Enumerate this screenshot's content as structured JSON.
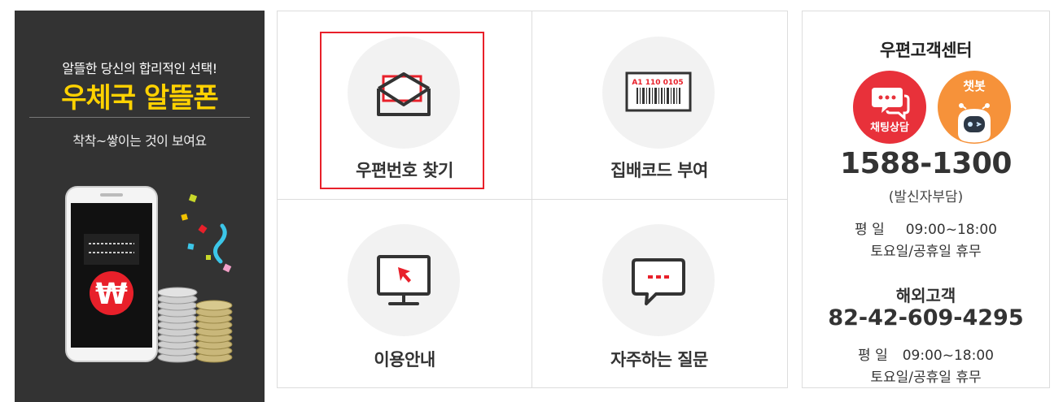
{
  "banner": {
    "tagline": "알뜰한 당신의 합리적인 선택!",
    "headline": "우체국 알뜰폰",
    "subline": "착착~쌓이는 것이 보여요",
    "won_symbol": "₩",
    "colors": {
      "background": "#333333",
      "headline": "#ffd200",
      "badge": "#e8202a"
    }
  },
  "menu": {
    "items": [
      {
        "label": "우편번호 찾기",
        "icon": "envelope-icon",
        "selected": true
      },
      {
        "label": "집배코드 부여",
        "icon": "barcode-label-icon",
        "barcode_text": "A1 110 0105"
      },
      {
        "label": "이용안내",
        "icon": "monitor-cursor-icon"
      },
      {
        "label": "자주하는 질문",
        "icon": "speech-bubble-icon"
      }
    ],
    "colors": {
      "highlight": "#e8202a",
      "icon_circle": "#f2f2f2"
    }
  },
  "support": {
    "title": "우편고객센터",
    "chat_label": "채팅상담",
    "bot_label": "챗봇",
    "phone": "1588-1300",
    "phone_note": "(발신자부담)",
    "weekday_label": "평 일",
    "weekday_hours": "09:00~18:00",
    "holiday_text": "토요일/공휴일 휴무",
    "overseas_title": "해외고객",
    "overseas_phone": "82-42-609-4295",
    "colors": {
      "chat": "#e8313a",
      "bot": "#f6923a"
    }
  }
}
